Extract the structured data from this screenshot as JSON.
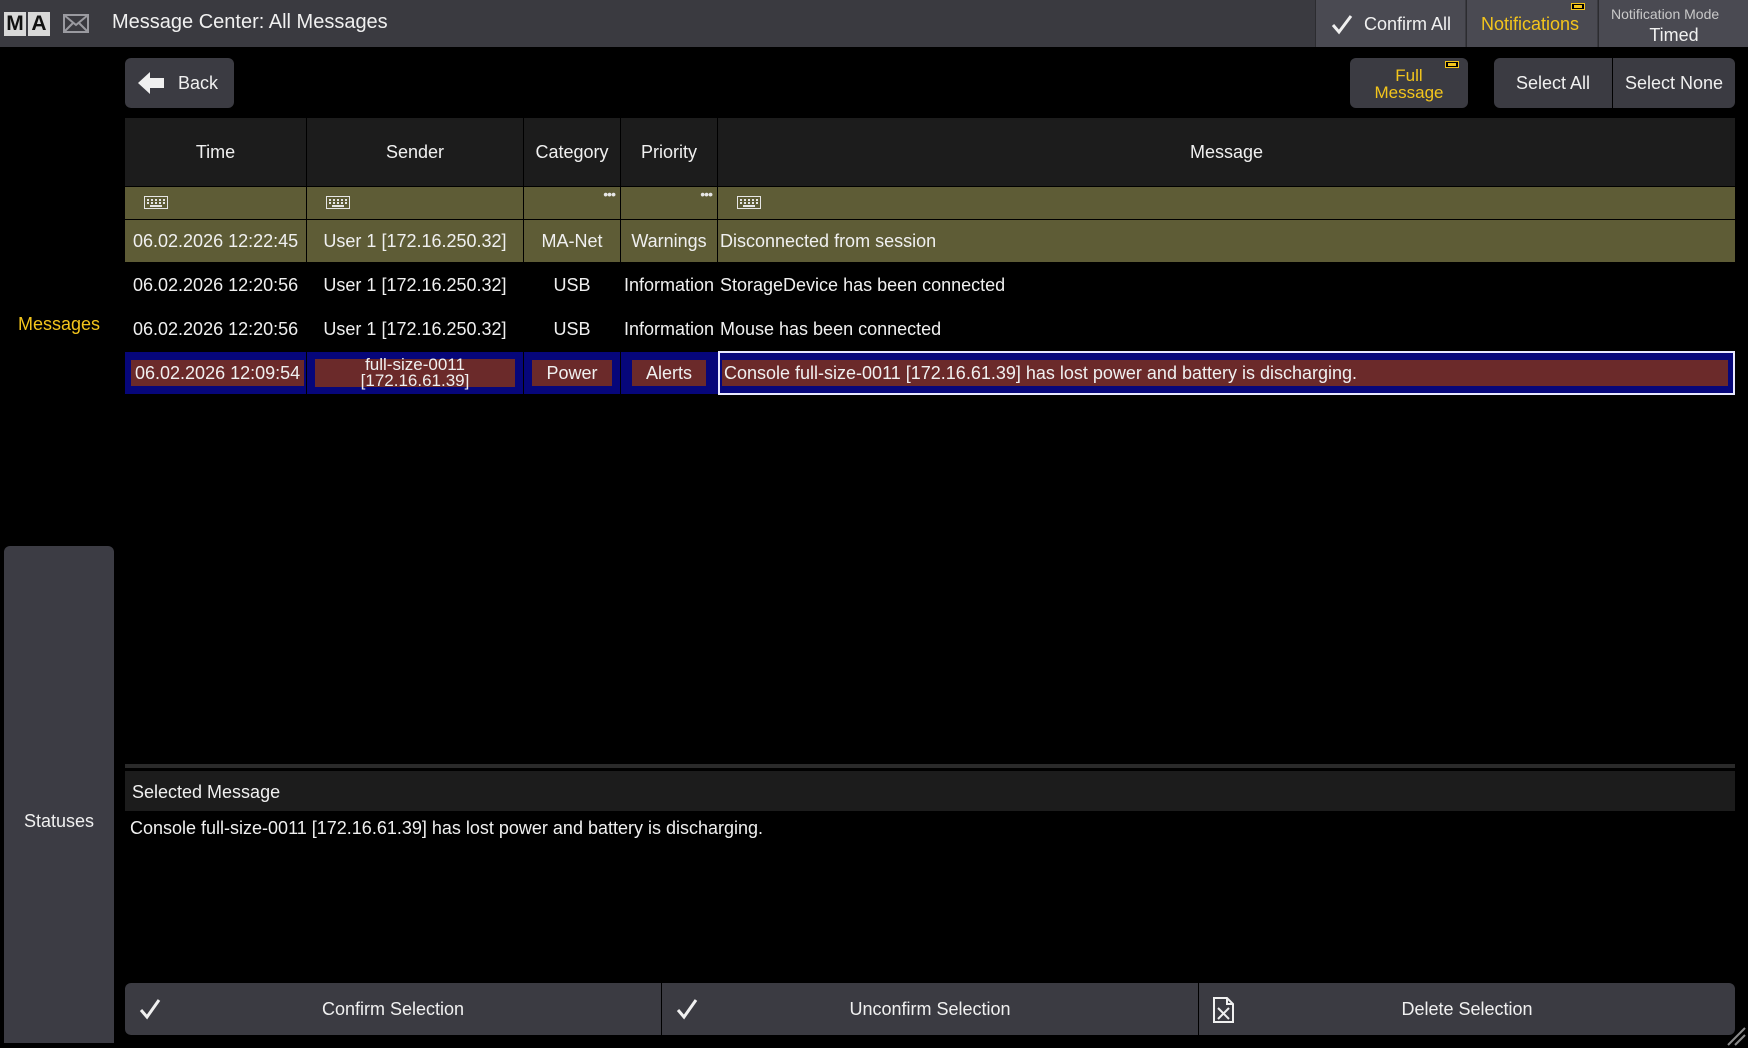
{
  "titlebar": {
    "logo_m": "M",
    "logo_a": "A",
    "title": "Message Center: All Messages",
    "confirm_all": "Confirm All",
    "notifications": "Notifications",
    "notification_mode_caption": "Notification Mode",
    "notification_mode_value": "Timed"
  },
  "sidebar": {
    "messages": "Messages",
    "statuses": "Statuses"
  },
  "toolbar": {
    "back": "Back",
    "full_message_line1": "Full",
    "full_message_line2": "Message",
    "select_all": "Select All",
    "select_none": "Select None"
  },
  "table": {
    "headers": [
      "Time",
      "Sender",
      "Category",
      "Priority",
      "Message"
    ],
    "rows": [
      {
        "time": "06.02.2026 12:22:45",
        "sender": "User 1 [172.16.250.32]",
        "category": "MA-Net",
        "priority": "Warnings",
        "message": "Disconnected from session"
      },
      {
        "time": "06.02.2026 12:20:56",
        "sender": "User 1 [172.16.250.32]",
        "category": "USB",
        "priority": "Information",
        "message": "StorageDevice has been connected"
      },
      {
        "time": "06.02.2026 12:20:56",
        "sender": "User 1 [172.16.250.32]",
        "category": "USB",
        "priority": "Information",
        "message": "Mouse has been connected"
      },
      {
        "time": "06.02.2026 12:09:54",
        "sender_line1": "full-size-0011",
        "sender_line2": "[172.16.61.39]",
        "category": "Power",
        "priority": "Alerts",
        "message": "Console full-size-0011 [172.16.61.39] has lost power and battery is discharging."
      }
    ]
  },
  "selected_message": {
    "header": "Selected Message",
    "text": "Console full-size-0011 [172.16.61.39] has lost power and battery is discharging."
  },
  "actions": {
    "confirm": "Confirm Selection",
    "unconfirm": "Unconfirm Selection",
    "delete": "Delete Selection"
  },
  "colors": {
    "accent": "#f3c51c",
    "row_highlight": "#5e5c36",
    "selected_row": "#06067a",
    "alert_box": "#6b2a2a"
  }
}
